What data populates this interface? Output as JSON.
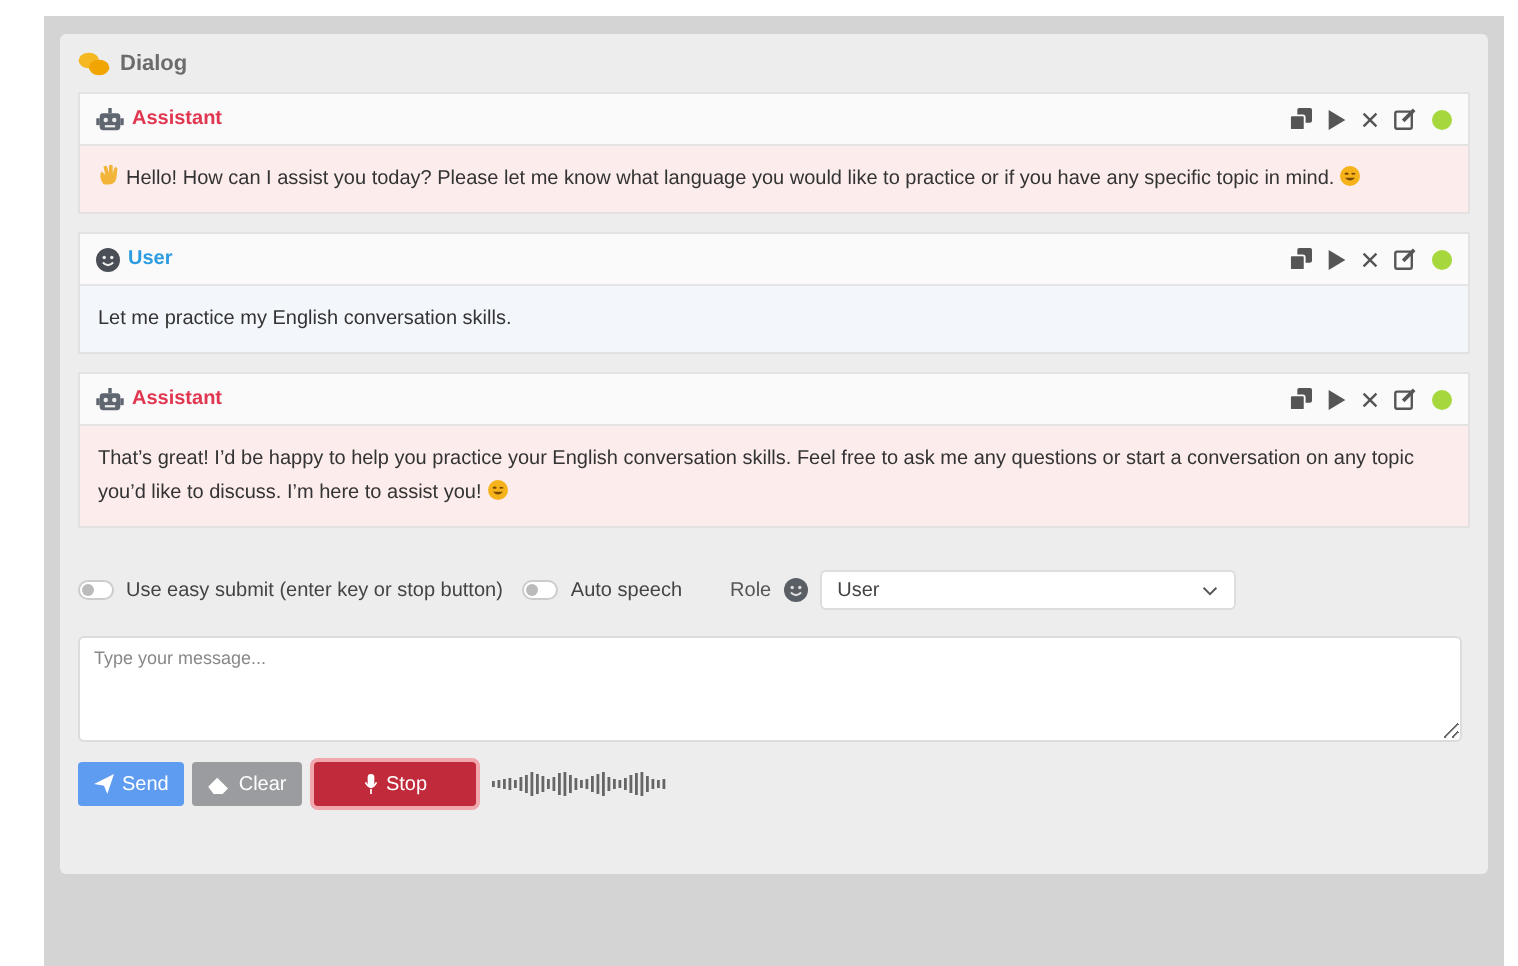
{
  "dialog": {
    "title": "Dialog"
  },
  "messages": [
    {
      "kind": "assistant",
      "name": "Assistant",
      "text": "Hello! How can I assist you today? Please let me know what language you would like to practice or if you have any specific topic in mind.",
      "lead_emoji": true,
      "trail_emoji": true
    },
    {
      "kind": "user",
      "name": "User",
      "text": "Let me practice my English conversation skills.",
      "lead_emoji": false,
      "trail_emoji": false
    },
    {
      "kind": "assistant",
      "name": "Assistant",
      "text": "That’s great! I’d be happy to help you practice your English conversation skills. Feel free to ask me any questions or start a conversation on any topic you’d like to discuss. I’m here to assist you!",
      "lead_emoji": false,
      "trail_emoji": true
    }
  ],
  "options": [
    {
      "label": "Use easy submit (enter key or stop button)",
      "on": false
    },
    {
      "label": "Auto speech",
      "on": false
    }
  ],
  "role": {
    "label": "Role",
    "value": "User"
  },
  "input": {
    "placeholder": "Type your message..."
  },
  "buttons": [
    {
      "kind": "send",
      "label": "Send"
    },
    {
      "kind": "clear",
      "label": "Clear"
    },
    {
      "kind": "stop",
      "label": "Stop"
    }
  ],
  "recording": true
}
